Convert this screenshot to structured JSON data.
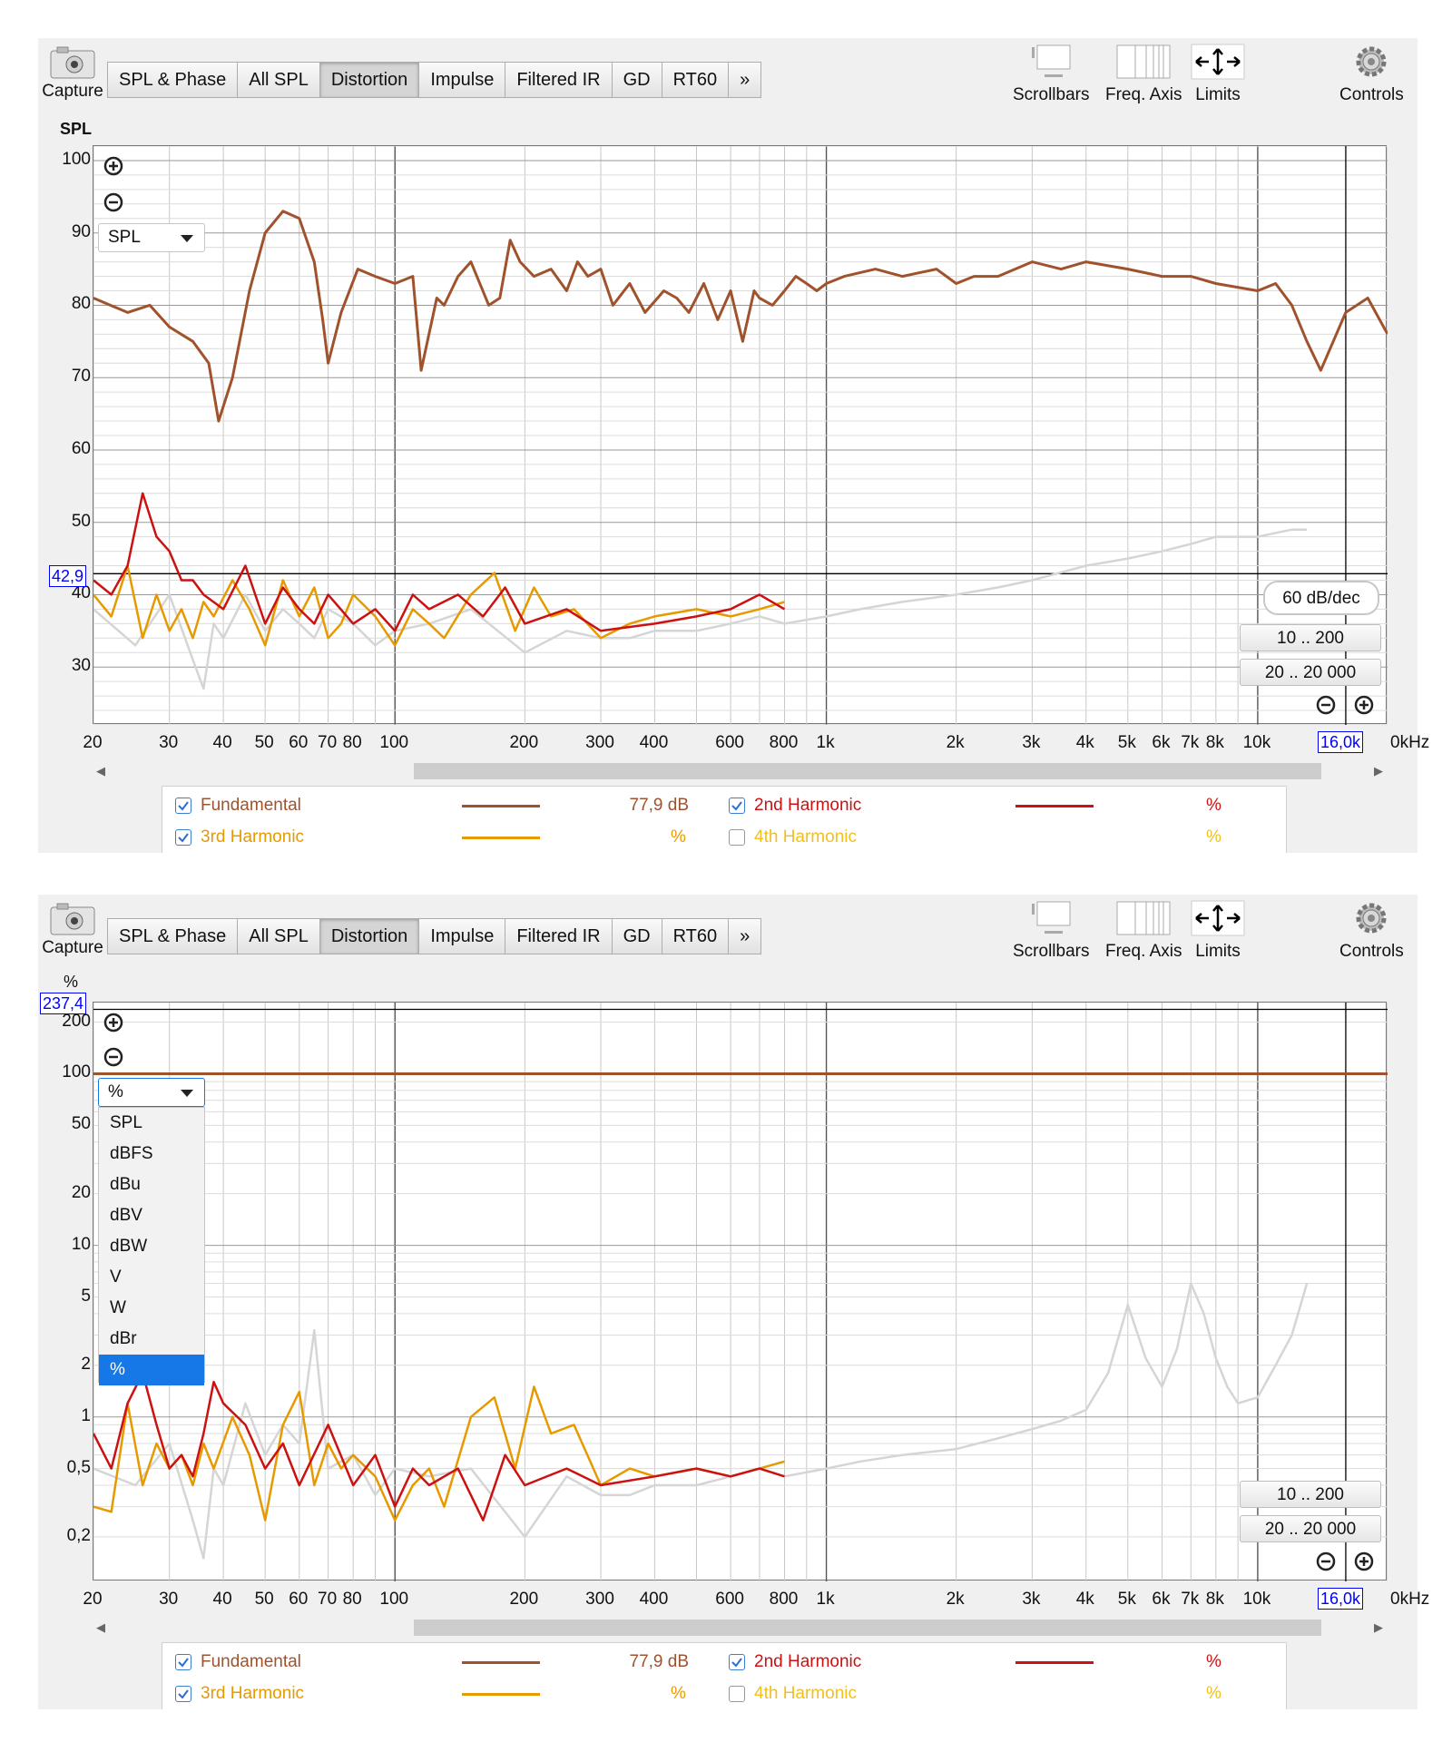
{
  "toolbar": {
    "capture_label": "Capture",
    "tabs": [
      "SPL & Phase",
      "All SPL",
      "Distortion",
      "Impulse",
      "Filtered IR",
      "GD",
      "RT60",
      "»"
    ],
    "active_tab": "Distortion",
    "scrollbars_label": "Scrollbars",
    "freq_axis_label": "Freq. Axis",
    "limits_label": "Limits",
    "controls_label": "Controls"
  },
  "x_axis": {
    "ticks": [
      {
        "f": 20,
        "label": "20"
      },
      {
        "f": 30,
        "label": "30"
      },
      {
        "f": 40,
        "label": "40"
      },
      {
        "f": 50,
        "label": "50"
      },
      {
        "f": 60,
        "label": "60"
      },
      {
        "f": 70,
        "label": "70"
      },
      {
        "f": 80,
        "label": "80"
      },
      {
        "f": 100,
        "label": "100"
      },
      {
        "f": 200,
        "label": "200"
      },
      {
        "f": 300,
        "label": "300"
      },
      {
        "f": 400,
        "label": "400"
      },
      {
        "f": 600,
        "label": "600"
      },
      {
        "f": 800,
        "label": "800"
      },
      {
        "f": 1000,
        "label": "1k"
      },
      {
        "f": 2000,
        "label": "2k"
      },
      {
        "f": 3000,
        "label": "3k"
      },
      {
        "f": 4000,
        "label": "4k"
      },
      {
        "f": 5000,
        "label": "5k"
      },
      {
        "f": 6000,
        "label": "6k"
      },
      {
        "f": 7000,
        "label": "7k"
      },
      {
        "f": 8000,
        "label": "8k"
      },
      {
        "f": 10000,
        "label": "10k"
      }
    ],
    "end_label": "0kHz",
    "cursor_label": "16,0k",
    "cursor_f": 16000
  },
  "panel1": {
    "y_title": "SPL",
    "y_ticks": [
      "100",
      "90",
      "80",
      "70",
      "60",
      "50",
      "40",
      "30"
    ],
    "cursor_y_label": "42,9",
    "dropdown_value": "SPL",
    "slope_button": "60 dB/dec",
    "range_buttons": [
      "10 .. 200",
      "20 .. 20 000"
    ]
  },
  "panel2": {
    "y_title": "%",
    "y_ticks": [
      "200",
      "100",
      "50",
      "20",
      "10",
      "5",
      "2",
      "1",
      "0,5",
      "0,2"
    ],
    "cursor_y_label": "237,4",
    "dropdown_value": "%",
    "dropdown_options": [
      "SPL",
      "dBFS",
      "dBu",
      "dBV",
      "dBW",
      "V",
      "W",
      "dBr",
      "%"
    ],
    "dropdown_selected": "%",
    "range_buttons": [
      "10 .. 200",
      "20 .. 20 000"
    ]
  },
  "legend": {
    "fundamental": {
      "label": "Fundamental",
      "value": "77,9 dB",
      "checked": true,
      "color": "#a0522d"
    },
    "h2": {
      "label": "2nd Harmonic",
      "value": "%",
      "checked": true,
      "color": "#cc1111"
    },
    "h3": {
      "label": "3rd Harmonic",
      "value": "%",
      "checked": true,
      "color": "#e69a00"
    },
    "h4": {
      "label": "4th Harmonic",
      "value": "%",
      "checked": false,
      "color": "#f0c020"
    }
  },
  "chart_data": [
    {
      "type": "line",
      "title": "",
      "ylabel": "SPL",
      "xscale": "log",
      "xlim": [
        20,
        20000
      ],
      "ylim": [
        22,
        102
      ],
      "cursor": {
        "x": 16000,
        "y": 42.9
      },
      "series": [
        {
          "name": "Fundamental",
          "color": "#a0522d",
          "x": [
            20,
            24,
            27,
            30,
            34,
            37,
            39,
            42,
            46,
            50,
            55,
            60,
            65,
            68,
            70,
            75,
            82,
            90,
            100,
            110,
            115,
            125,
            130,
            140,
            150,
            165,
            175,
            185,
            195,
            210,
            230,
            250,
            265,
            280,
            300,
            320,
            350,
            380,
            420,
            450,
            480,
            520,
            560,
            600,
            640,
            680,
            700,
            750,
            800,
            850,
            900,
            950,
            1000,
            1100,
            1300,
            1500,
            1800,
            2000,
            2200,
            2500,
            3000,
            3500,
            4000,
            5000,
            6000,
            7000,
            8000,
            10000,
            11000,
            12000,
            13000,
            14000,
            16000,
            18000,
            20000
          ],
          "y": [
            81,
            79,
            80,
            77,
            75,
            72,
            64,
            70,
            82,
            90,
            93,
            92,
            86,
            78,
            72,
            79,
            85,
            84,
            83,
            84,
            71,
            81,
            80,
            84,
            86,
            80,
            81,
            89,
            86,
            84,
            85,
            82,
            86,
            84,
            85,
            80,
            83,
            79,
            82,
            81,
            79,
            83,
            78,
            82,
            75,
            82,
            81,
            80,
            82,
            84,
            83,
            82,
            83,
            84,
            85,
            84,
            85,
            83,
            84,
            84,
            86,
            85,
            86,
            85,
            84,
            84,
            83,
            82,
            83,
            80,
            75,
            71,
            79,
            81,
            76
          ]
        },
        {
          "name": "2nd Harmonic",
          "color": "#cc1111",
          "x": [
            20,
            22,
            24,
            26,
            28,
            30,
            32,
            34,
            36,
            40,
            45,
            50,
            55,
            60,
            65,
            70,
            80,
            90,
            100,
            110,
            120,
            140,
            160,
            180,
            200,
            250,
            300,
            400,
            500,
            600,
            700,
            800
          ],
          "y": [
            42,
            40,
            44,
            54,
            48,
            46,
            42,
            42,
            40,
            38,
            44,
            36,
            41,
            38,
            36,
            40,
            36,
            38,
            35,
            40,
            38,
            40,
            37,
            41,
            36,
            38,
            35,
            36,
            37,
            38,
            40,
            38
          ]
        },
        {
          "name": "3rd Harmonic",
          "color": "#e69a00",
          "x": [
            20,
            22,
            24,
            26,
            28,
            30,
            32,
            34,
            36,
            38,
            42,
            46,
            50,
            55,
            60,
            65,
            70,
            75,
            80,
            90,
            100,
            110,
            120,
            130,
            150,
            170,
            190,
            210,
            230,
            260,
            300,
            350,
            400,
            500,
            600,
            700,
            800
          ],
          "y": [
            40,
            37,
            44,
            34,
            40,
            35,
            38,
            34,
            39,
            37,
            42,
            38,
            33,
            42,
            37,
            41,
            34,
            36,
            40,
            37,
            33,
            38,
            36,
            34,
            40,
            43,
            35,
            41,
            37,
            38,
            34,
            36,
            37,
            38,
            37,
            38,
            39
          ]
        },
        {
          "name": "4th Harmonic",
          "color": "#d5d5d5",
          "x": [
            20,
            25,
            30,
            34,
            36,
            38,
            40,
            45,
            50,
            55,
            60,
            65,
            70,
            80,
            90,
            100,
            120,
            150,
            200,
            250,
            300,
            350,
            400,
            500,
            600,
            700,
            800,
            1000,
            1200,
            1500,
            2000,
            2500,
            3000,
            4000,
            5000,
            6000,
            7000,
            8000,
            10000,
            12000,
            13000
          ],
          "y": [
            38,
            33,
            40,
            31,
            27,
            36,
            34,
            40,
            35,
            38,
            36,
            34,
            38,
            36,
            33,
            35,
            36,
            38,
            32,
            35,
            34,
            34,
            35,
            35,
            36,
            37,
            36,
            37,
            38,
            39,
            40,
            41,
            42,
            44,
            45,
            46,
            47,
            48,
            48,
            49,
            49
          ]
        }
      ]
    },
    {
      "type": "line",
      "title": "",
      "ylabel": "%",
      "xscale": "log",
      "yscale": "log",
      "xlim": [
        20,
        20000
      ],
      "ylim": [
        0.11,
        260
      ],
      "cursor": {
        "x": 16000,
        "y": 237.4
      },
      "series": [
        {
          "name": "Fundamental",
          "color": "#a0522d",
          "x": [
            20,
            20000
          ],
          "y": [
            100,
            100
          ]
        },
        {
          "name": "2nd Harmonic",
          "color": "#cc1111",
          "x": [
            20,
            22,
            24,
            26,
            28,
            30,
            32,
            34,
            36,
            38,
            40,
            45,
            50,
            55,
            60,
            70,
            80,
            90,
            100,
            110,
            120,
            140,
            160,
            180,
            200,
            250,
            300,
            400,
            500,
            600,
            700,
            800
          ],
          "y": [
            0.8,
            0.5,
            1.2,
            1.8,
            0.9,
            0.5,
            0.6,
            0.45,
            0.8,
            1.6,
            1.2,
            0.9,
            0.5,
            0.7,
            0.4,
            0.9,
            0.4,
            0.6,
            0.3,
            0.5,
            0.4,
            0.5,
            0.25,
            0.6,
            0.4,
            0.5,
            0.4,
            0.45,
            0.5,
            0.45,
            0.5,
            0.45
          ]
        },
        {
          "name": "3rd Harmonic",
          "color": "#e69a00",
          "x": [
            20,
            22,
            24,
            26,
            28,
            30,
            32,
            34,
            36,
            38,
            42,
            46,
            50,
            55,
            60,
            65,
            70,
            75,
            80,
            90,
            100,
            110,
            120,
            130,
            150,
            170,
            190,
            210,
            230,
            260,
            300,
            350,
            400,
            500,
            600,
            700,
            800
          ],
          "y": [
            0.3,
            0.28,
            1.2,
            0.4,
            0.7,
            0.5,
            0.6,
            0.4,
            0.7,
            0.5,
            1.0,
            0.6,
            0.25,
            0.9,
            1.4,
            0.4,
            0.7,
            0.5,
            0.6,
            0.45,
            0.25,
            0.4,
            0.5,
            0.3,
            1.0,
            1.3,
            0.5,
            1.5,
            0.8,
            0.9,
            0.4,
            0.5,
            0.45,
            0.5,
            0.45,
            0.5,
            0.55
          ]
        },
        {
          "name": "4th Harmonic",
          "color": "#d5d5d5",
          "x": [
            20,
            25,
            30,
            34,
            36,
            38,
            40,
            45,
            50,
            55,
            60,
            65,
            70,
            80,
            90,
            100,
            120,
            150,
            200,
            250,
            300,
            350,
            400,
            500,
            600,
            700,
            800,
            1000,
            1200,
            1500,
            2000,
            2500,
            3000,
            3500,
            4000,
            4500,
            5000,
            5500,
            6000,
            6500,
            7000,
            7500,
            8000,
            8500,
            9000,
            10000,
            11000,
            12000,
            13000
          ],
          "y": [
            0.5,
            0.4,
            0.7,
            0.25,
            0.15,
            0.5,
            0.4,
            1.2,
            0.6,
            0.9,
            0.7,
            3.2,
            0.5,
            0.6,
            0.35,
            0.5,
            0.45,
            0.5,
            0.2,
            0.45,
            0.35,
            0.35,
            0.4,
            0.4,
            0.45,
            0.5,
            0.45,
            0.5,
            0.55,
            0.6,
            0.65,
            0.75,
            0.85,
            0.95,
            1.1,
            1.8,
            4.5,
            2.2,
            1.5,
            2.5,
            6.0,
            4.0,
            2.2,
            1.5,
            1.2,
            1.3,
            2.0,
            3.0,
            6.0
          ]
        }
      ]
    }
  ]
}
